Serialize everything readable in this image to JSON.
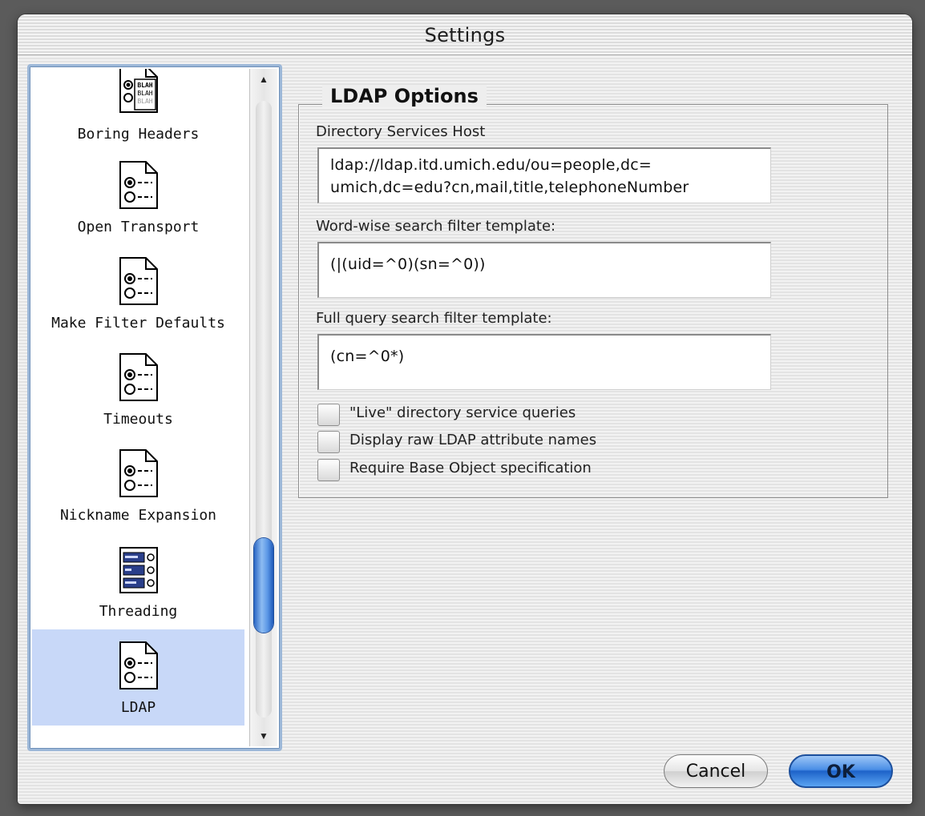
{
  "window": {
    "title": "Settings"
  },
  "sidebar": {
    "items": [
      {
        "label": "Boring Headers",
        "icon": "blah-document-icon",
        "selected": false
      },
      {
        "label": "Open Transport",
        "icon": "radio-options-document-icon",
        "selected": false
      },
      {
        "label": "Make Filter Defaults",
        "icon": "radio-options-document-icon",
        "selected": false
      },
      {
        "label": "Timeouts",
        "icon": "radio-options-document-icon",
        "selected": false
      },
      {
        "label": "Nickname Expansion",
        "icon": "radio-options-document-icon",
        "selected": false
      },
      {
        "label": "Threading",
        "icon": "threading-panel-icon",
        "selected": false
      },
      {
        "label": "LDAP",
        "icon": "radio-options-document-icon",
        "selected": true
      }
    ],
    "scroll_up_glyph": "▲",
    "scroll_down_glyph": "▼"
  },
  "panel": {
    "group_title": "LDAP Options",
    "host_label": "Directory Services Host",
    "host_value_line1": "ldap://ldap.itd.umich.edu/ou=people,dc=",
    "host_value_line2": "umich,dc=edu?cn,mail,title,telephoneNumber",
    "wordwise_label": "Word-wise search filter template:",
    "wordwise_value": "(|(uid=^0)(sn=^0))",
    "fullquery_label": "Full query search filter template:",
    "fullquery_value": "(cn=^0*)",
    "checkboxes": [
      {
        "label": "\"Live\" directory service queries",
        "checked": false
      },
      {
        "label": "Display raw LDAP attribute names",
        "checked": false
      },
      {
        "label": "Require Base Object specification",
        "checked": false
      }
    ]
  },
  "buttons": {
    "cancel": "Cancel",
    "ok": "OK"
  },
  "colors": {
    "selection": "#c8d8f8",
    "accent": "#2b67c4"
  }
}
